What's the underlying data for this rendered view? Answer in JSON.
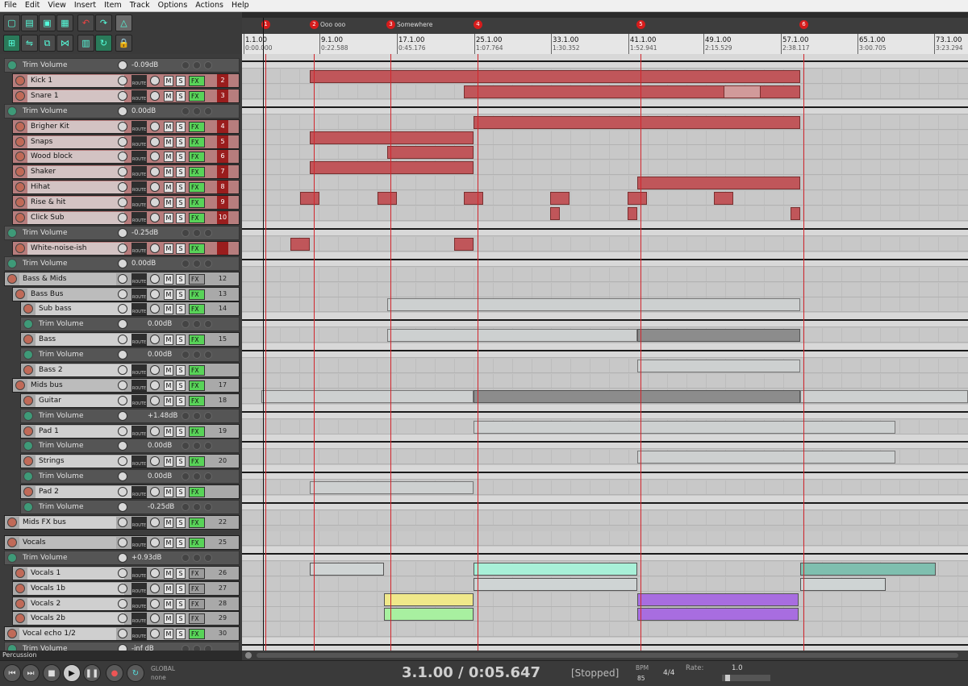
{
  "menu": [
    "File",
    "Edit",
    "View",
    "Insert",
    "Item",
    "Track",
    "Options",
    "Actions",
    "Help"
  ],
  "colors": {
    "red_item": "#c0565a",
    "grey_item": "#cdd0d0",
    "marker": "#d61c1c",
    "fx_on": "#58d358"
  },
  "labels": {
    "m": "M",
    "s": "S",
    "fx": "FX",
    "route": "ROUTE"
  },
  "markers": [
    {
      "num": "1",
      "name": ""
    },
    {
      "num": "2",
      "name": "Ooo ooo"
    },
    {
      "num": "3",
      "name": "Somewhere"
    },
    {
      "num": "4",
      "name": ""
    },
    {
      "num": "5",
      "name": ""
    },
    {
      "num": "6",
      "name": ""
    }
  ],
  "ruler": [
    {
      "bar": "1.1.00",
      "time": "0:00.000"
    },
    {
      "bar": "9.1.00",
      "time": "0:22.588"
    },
    {
      "bar": "17.1.00",
      "time": "0:45.176"
    },
    {
      "bar": "25.1.00",
      "time": "1:07.764"
    },
    {
      "bar": "33.1.00",
      "time": "1:30.352"
    },
    {
      "bar": "41.1.00",
      "time": "1:52.941"
    },
    {
      "bar": "49.1.00",
      "time": "2:15.529"
    },
    {
      "bar": "57.1.00",
      "time": "2:38.117"
    },
    {
      "bar": "65.1.00",
      "time": "3:00.705"
    },
    {
      "bar": "73.1.00",
      "time": "3:23.294"
    }
  ],
  "tracks": [
    {
      "type": "env",
      "name": "Trim Volume",
      "value": "-0.09dB"
    },
    {
      "type": "red",
      "name": "Kick 1",
      "num": "2"
    },
    {
      "type": "red",
      "name": "Snare 1",
      "num": "3"
    },
    {
      "type": "env",
      "name": "Trim Volume",
      "value": "0.00dB"
    },
    {
      "type": "red",
      "name": "Brigher Kit",
      "num": "4"
    },
    {
      "type": "red",
      "name": "Snaps",
      "num": "5"
    },
    {
      "type": "red",
      "name": "Wood block",
      "num": "6"
    },
    {
      "type": "red",
      "name": "Shaker",
      "num": "7"
    },
    {
      "type": "red",
      "name": "Hihat",
      "num": "8"
    },
    {
      "type": "red",
      "name": "Rise & hit",
      "num": "9"
    },
    {
      "type": "red",
      "name": "Click Sub",
      "num": "10"
    },
    {
      "type": "env",
      "name": "Trim Volume",
      "value": "-0.25dB"
    },
    {
      "type": "red",
      "name": "White-noise-ish",
      "num": ""
    },
    {
      "type": "env",
      "name": "Trim Volume",
      "value": "0.00dB"
    },
    {
      "type": "grey",
      "name": "Bass & Mids",
      "num": "12"
    },
    {
      "type": "grey",
      "name": "Bass Bus",
      "num": "13"
    },
    {
      "type": "grey",
      "name": "Sub bass",
      "num": "14"
    },
    {
      "type": "env",
      "name": "Trim Volume",
      "value": "0.00dB"
    },
    {
      "type": "grey",
      "name": "Bass",
      "num": "15"
    },
    {
      "type": "env",
      "name": "Trim Volume",
      "value": "0.00dB"
    },
    {
      "type": "grey",
      "name": "Bass 2",
      "num": ""
    },
    {
      "type": "grey",
      "name": "Mids bus",
      "num": "17"
    },
    {
      "type": "grey",
      "name": "Guitar",
      "num": "18"
    },
    {
      "type": "env",
      "name": "Trim Volume",
      "value": "+1.48dB"
    },
    {
      "type": "grey",
      "name": "Pad 1",
      "num": "19"
    },
    {
      "type": "env",
      "name": "Trim Volume",
      "value": "0.00dB"
    },
    {
      "type": "grey",
      "name": "Strings",
      "num": "20"
    },
    {
      "type": "env",
      "name": "Trim Volume",
      "value": "0.00dB"
    },
    {
      "type": "grey",
      "name": "Pad 2",
      "num": ""
    },
    {
      "type": "env",
      "name": "Trim Volume",
      "value": "-0.25dB"
    },
    {
      "type": "grey",
      "name": "Mids FX bus",
      "num": "22"
    },
    {
      "type": "grey",
      "name": "Vocals",
      "num": "25"
    },
    {
      "type": "env",
      "name": "Trim Volume",
      "value": "+0.93dB"
    },
    {
      "type": "grey",
      "name": "Vocals 1",
      "num": "26"
    },
    {
      "type": "grey",
      "name": "Vocals 1b",
      "num": "27"
    },
    {
      "type": "grey",
      "name": "Vocals 2",
      "num": "28"
    },
    {
      "type": "grey",
      "name": "Vocals 2b",
      "num": "29"
    },
    {
      "type": "grey",
      "name": "Vocal echo 1/2",
      "num": "30"
    },
    {
      "type": "env",
      "name": "Trim Volume",
      "value": "-inf dB"
    }
  ],
  "status_track": "Percussion",
  "transport": {
    "time": "3.1.00 / 0:05.647",
    "state": "[Stopped]",
    "bpm_label": "BPM",
    "bpm": "85",
    "meter": "4/4",
    "rate_label": "Rate:",
    "rate": "1.0",
    "global_label": "GLOBAL",
    "global_value": "none"
  }
}
